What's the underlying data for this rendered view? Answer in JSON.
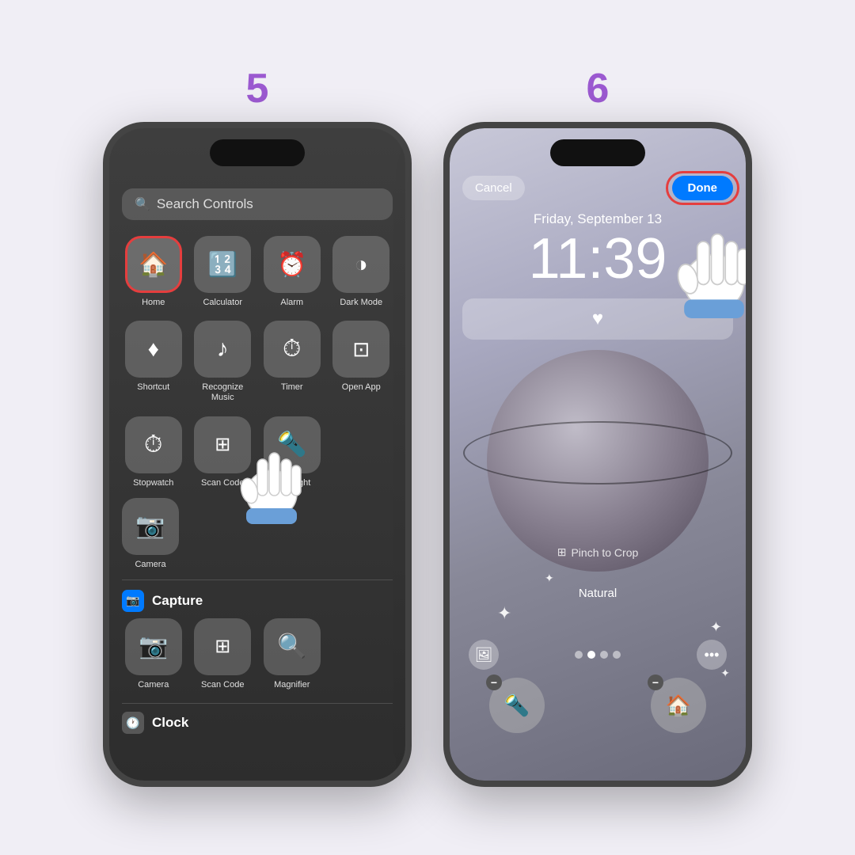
{
  "steps": {
    "step5": {
      "number": "5",
      "search_placeholder": "Search Controls",
      "controls": [
        {
          "label": "Home",
          "icon": "🏠",
          "highlighted": true
        },
        {
          "label": "Calculator",
          "icon": "🔢",
          "highlighted": false
        },
        {
          "label": "Alarm",
          "icon": "⏰",
          "highlighted": false
        },
        {
          "label": "Dark Mode",
          "icon": "◑",
          "highlighted": false
        },
        {
          "label": "Shortcut",
          "icon": "♦",
          "highlighted": false
        },
        {
          "label": "Recognize Music",
          "icon": "♪",
          "highlighted": false
        },
        {
          "label": "Timer",
          "icon": "⏱",
          "highlighted": false
        },
        {
          "label": "Open App",
          "icon": "⊡",
          "highlighted": false
        },
        {
          "label": "Stopwatch",
          "icon": "⏱",
          "highlighted": false
        },
        {
          "label": "Scan Code",
          "icon": "⊞",
          "highlighted": false
        },
        {
          "label": "Flashlight",
          "icon": "🔦",
          "highlighted": false
        }
      ],
      "section_capture": "Capture",
      "section_capture_items": [
        {
          "label": "Camera",
          "icon": "📷"
        },
        {
          "label": "Scan Code",
          "icon": "⊞"
        },
        {
          "label": "Magnifier",
          "icon": "🔍"
        }
      ],
      "section_clock": "Clock"
    },
    "step6": {
      "number": "6",
      "cancel_label": "Cancel",
      "done_label": "Done",
      "date": "Friday, September 13",
      "time": "11:39",
      "pinch_to_crop": "Pinch to Crop",
      "natural_label": "Natural"
    }
  }
}
